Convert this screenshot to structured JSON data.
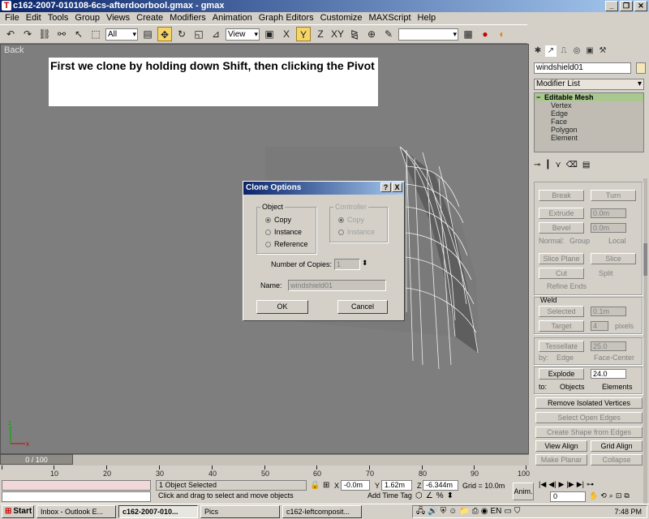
{
  "window": {
    "title": "c162-2007-010108-6cs-afterdoorbool.gmax - gmax",
    "app_icon": "gmax-icon"
  },
  "menu": [
    "File",
    "Edit",
    "Tools",
    "Group",
    "Views",
    "Create",
    "Modifiers",
    "Animation",
    "Graph Editors",
    "Customize",
    "MAXScript",
    "Help"
  ],
  "toolbar": {
    "selection_filter": "All",
    "coord_system": "View",
    "named_selection": ""
  },
  "viewport": {
    "label": "Back",
    "annotation": "First we clone by holding down Shift, then clicking the Pivot"
  },
  "dialog": {
    "title": "Clone Options",
    "object_group": "Object",
    "object_options": [
      "Copy",
      "Instance",
      "Reference"
    ],
    "controller_group": "Controller",
    "controller_options": [
      "Copy",
      "Instance"
    ],
    "copies_label": "Number of Copies:",
    "copies_value": "1",
    "name_label": "Name:",
    "name_value": "windshield01",
    "ok": "OK",
    "cancel": "Cancel",
    "help_btn": "?",
    "close_btn": "X"
  },
  "panel": {
    "object_name": "windshield01",
    "modifier_list": "Modifier List",
    "stack_root": "Editable Mesh",
    "stack_items": [
      "Vertex",
      "Edge",
      "Face",
      "Polygon",
      "Element"
    ],
    "break": "Break",
    "turn": "Turn",
    "extrude": "Extrude",
    "extrude_val": "0.0m",
    "bevel": "Bevel",
    "bevel_val": "0.0m",
    "normal_label": "Normal:",
    "normal_group": "Group",
    "normal_local": "Local",
    "slice_plane": "Slice Plane",
    "slice": "Slice",
    "cut": "Cut",
    "split": "Split",
    "refine_ends": "Refine Ends",
    "weld_title": "Weld",
    "weld_selected": "Selected",
    "weld_selected_val": "0.1m",
    "weld_target": "Target",
    "weld_target_val": "4",
    "pixels": "pixels",
    "tessellate": "Tessellate",
    "tessellate_val": "25.0",
    "by": "by:",
    "by_edge": "Edge",
    "by_face": "Face-Center",
    "explode": "Explode",
    "explode_val": "24.0",
    "to": "to:",
    "to_objects": "Objects",
    "to_elements": "Elements",
    "remove_isolated": "Remove Isolated Vertices",
    "select_open": "Select Open Edges",
    "create_shape": "Create Shape from Edges",
    "view_align": "View Align",
    "grid_align": "Grid Align",
    "make_planar": "Make Planar",
    "collapse": "Collapse"
  },
  "timeline": {
    "frame_display": "0 / 100",
    "ticks": [
      "10",
      "20",
      "30",
      "40",
      "50",
      "60",
      "70",
      "80",
      "90",
      "100"
    ]
  },
  "status": {
    "selected": "1 Object Selected",
    "prompt": "Click and drag to select and move objects",
    "x_label": "X",
    "x_val": "-0.0m",
    "y_label": "Y",
    "y_val": "1.62m",
    "z_label": "Z",
    "z_val": "-6.344m",
    "grid": "Grid = 10.0m",
    "add_time_tag": "Add Time Tag",
    "anim": "Anim.",
    "frame": "0"
  },
  "taskbar": {
    "start": "Start",
    "tasks": [
      "Inbox - Outlook E...",
      "c162-2007-010...",
      "Pics",
      "c162-leftcomposit..."
    ],
    "clock": "7:48 PM"
  }
}
